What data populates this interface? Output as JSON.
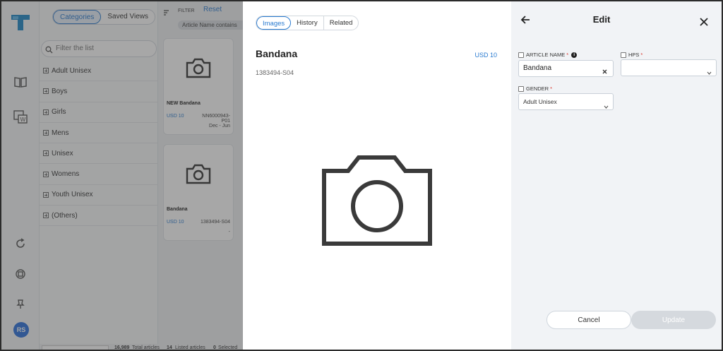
{
  "sidebar": {
    "segments": [
      "Categories",
      "Saved Views"
    ],
    "filter_placeholder": "Filter the list",
    "categories": [
      "Adult Unisex",
      "Boys",
      "Girls",
      "Mens",
      "Unisex",
      "Womens",
      "Youth Unisex",
      "(Others)"
    ],
    "avatar_initials": "RS"
  },
  "grid": {
    "filter_label": "FILTER",
    "reset_label": "Reset",
    "chip_text": "Article Name contains",
    "cards": [
      {
        "name": "NEW Bandana",
        "price": "USD 10",
        "article": "NN6000943-",
        "article2": "P01",
        "article3": "Dec - Jun"
      },
      {
        "name": "Bandana",
        "price": "USD 10",
        "article": "1383494-S04",
        "article2": "",
        "article3": "-"
      }
    ]
  },
  "footer": {
    "total_count": "16,989",
    "total_label": "Total articles",
    "listed_count": "14",
    "listed_label": "Listed articles",
    "selected_count": "0",
    "selected_label": "Selected"
  },
  "detail": {
    "tabs": [
      "Images",
      "History",
      "Related"
    ],
    "title": "Bandana",
    "price": "USD 10",
    "code": "1383494-S04"
  },
  "edit": {
    "title": "Edit",
    "article_name_label": "ARTICLE NAME",
    "article_name_value": "Bandana",
    "hps_label": "HPS",
    "hps_value": "",
    "gender_label": "GENDER",
    "gender_value": "Adult Unisex",
    "cancel_label": "Cancel",
    "update_label": "Update",
    "required_mark": "*"
  },
  "colors": {
    "accent": "#2a7bd0",
    "brand": "#1e88c7",
    "required": "#d93025"
  }
}
